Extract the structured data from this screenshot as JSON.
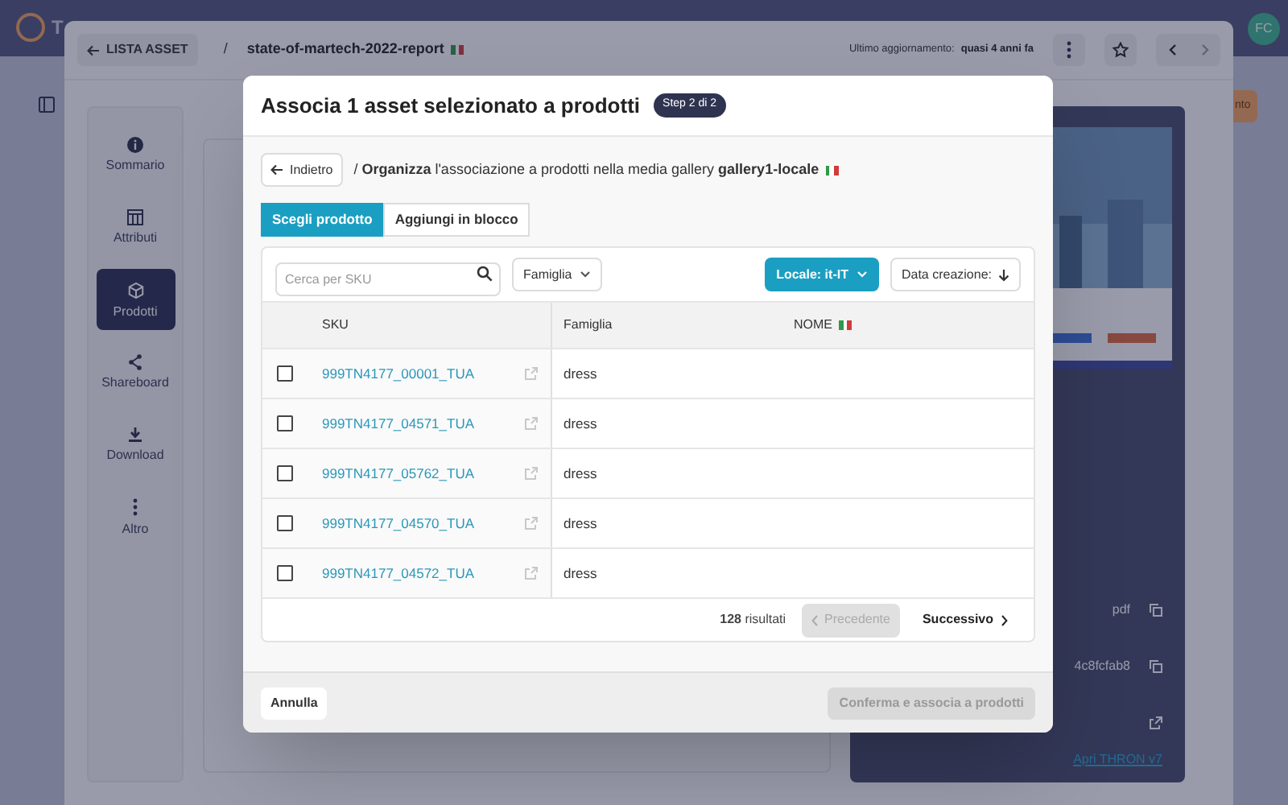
{
  "app": {
    "logo_text": "T",
    "avatar": "FC",
    "side_button": "nto"
  },
  "panel": {
    "back_button": "LISTA ASSET",
    "separator": "/",
    "asset_name": "state-of-martech-2022-report",
    "last_update_label": "Ultimo aggiornamento:",
    "last_update_value": "quasi 4 anni fa",
    "nav": [
      {
        "label": "Sommario",
        "kind": "info",
        "selected": false
      },
      {
        "label": "Attributi",
        "kind": "table",
        "selected": false
      },
      {
        "label": "Prodotti",
        "kind": "cube",
        "selected": true
      },
      {
        "label": "Shareboard",
        "kind": "share",
        "selected": false
      },
      {
        "label": "Download",
        "kind": "download",
        "selected": false
      },
      {
        "label": "Altro",
        "kind": "dots",
        "selected": false
      }
    ],
    "details": [
      {
        "text": "pdf",
        "kind": "copy"
      },
      {
        "text": "4c8fcfab8",
        "kind": "copy"
      },
      {
        "kind": "open"
      }
    ],
    "link": "Apri THRON v7"
  },
  "modal": {
    "title": "Associa 1 asset selezionato a prodotti",
    "step": "Step 2 di 2",
    "back_button": "Indietro",
    "breadcrumb": "/ **Organizza** l'associazione a prodotti nella media gallery **gallery1-locale**",
    "tabs": [
      {
        "label": "Scegli prodotto",
        "selected": true
      },
      {
        "label": "Aggiungi in blocco",
        "selected": false
      }
    ],
    "search": {
      "placeholder": "Cerca per SKU"
    },
    "family_filter": "Famiglia",
    "locale_filter": "Locale: it-IT",
    "sort": "Data creazione:",
    "columns": [
      "SKU",
      "Famiglia",
      "NOME"
    ],
    "rows": [
      {
        "sku": "999TN4177_00001_TUA",
        "family": "dress",
        "checked": false
      },
      {
        "sku": "999TN4177_04571_TUA",
        "family": "dress",
        "checked": false
      },
      {
        "sku": "999TN4177_05762_TUA",
        "family": "dress",
        "checked": false
      },
      {
        "sku": "999TN4177_04570_TUA",
        "family": "dress",
        "checked": false
      },
      {
        "sku": "999TN4177_04572_TUA",
        "family": "dress",
        "checked": false
      }
    ],
    "results": "**128** risultati",
    "prev": {
      "label": "Precedente",
      "disabled": true
    },
    "next": {
      "label": "Successivo",
      "disabled": false
    },
    "cancel": "Annulla",
    "confirm": {
      "label": "Conferma e associa a prodotti",
      "disabled": true
    }
  }
}
